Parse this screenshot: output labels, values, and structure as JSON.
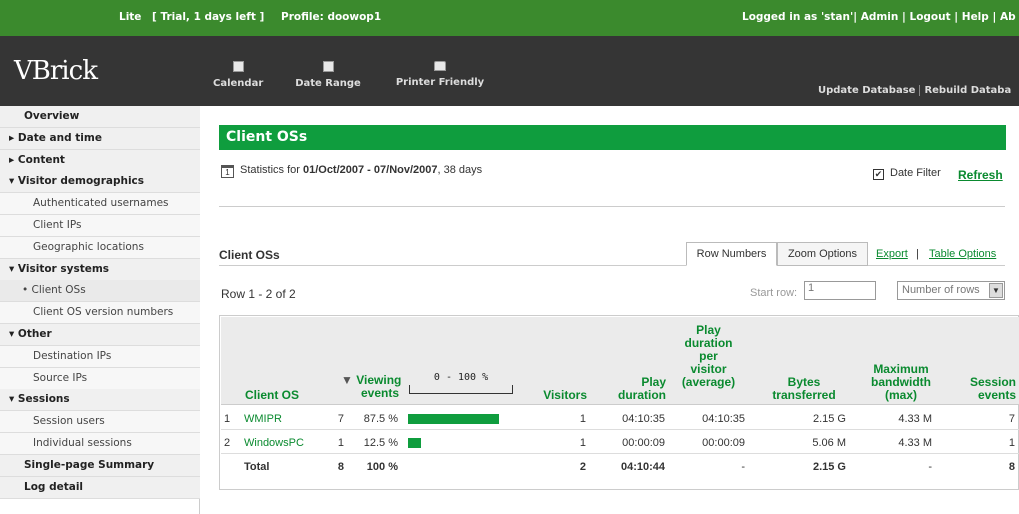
{
  "topbar": {
    "edition": "Lite",
    "trial": "[ Trial, 1 days left ]",
    "profile": "Profile: doowop1",
    "right": "Logged in as 'stan'| Admin | Logout | Help | Ab"
  },
  "header": {
    "logo": "VBrick",
    "tools": [
      {
        "label": "Calendar",
        "icon": "calendar-icon"
      },
      {
        "label": "Date Range",
        "icon": "date-range-icon"
      },
      {
        "label": "Printer Friendly",
        "icon": "printer-icon"
      }
    ],
    "update_db": "Update Database",
    "rebuild_db": "Rebuild Databa"
  },
  "sidebar": {
    "items": [
      {
        "label": "Overview",
        "kind": "top"
      },
      {
        "label": "▸ Date and time",
        "kind": "grp"
      },
      {
        "label": "▸ Content",
        "kind": "grp"
      },
      {
        "label": "▾ Visitor demographics",
        "kind": "grp"
      },
      {
        "label": "Authenticated usernames",
        "kind": "sub"
      },
      {
        "label": "Client IPs",
        "kind": "sub"
      },
      {
        "label": "Geographic locations",
        "kind": "sub"
      },
      {
        "label": "▾ Visitor systems",
        "kind": "grp"
      },
      {
        "label": "• Client OSs",
        "kind": "sub sel"
      },
      {
        "label": "Client OS version numbers",
        "kind": "sub"
      },
      {
        "label": "▾ Other",
        "kind": "grp"
      },
      {
        "label": "Destination IPs",
        "kind": "sub"
      },
      {
        "label": "Source IPs",
        "kind": "sub"
      },
      {
        "label": "▾ Sessions",
        "kind": "grp"
      },
      {
        "label": "Session users",
        "kind": "sub"
      },
      {
        "label": "Individual sessions",
        "kind": "sub"
      },
      {
        "label": "Single-page Summary",
        "kind": "top"
      },
      {
        "label": "Log detail",
        "kind": "top"
      }
    ]
  },
  "main": {
    "title": "Client OSs",
    "stats_prefix": "Statistics for",
    "stats_range": "01/Oct/2007 - 07/Nov/2007",
    "stats_suffix": ", 38 days",
    "date_filter_label": "Date Filter",
    "date_filter_checked": true,
    "refresh": "Refresh",
    "subtitle": "Client OSs",
    "tabs": {
      "row_numbers": "Row Numbers",
      "zoom_options": "Zoom Options"
    },
    "export": "Export",
    "link_sep": "|",
    "table_options": "Table Options",
    "row_count": "Row 1 - 2 of 2",
    "start_row_label": "Start row:",
    "start_row_value": "1",
    "num_rows_placeholder": "Number of rows"
  },
  "table": {
    "headers": {
      "client_os": "Client OS",
      "viewing_events": "Viewing\nevents",
      "sort_arrow": "▼",
      "scale": "0 - 100 %",
      "visitors": "Visitors",
      "play_duration": "Play\nduration",
      "play_per_visitor": "Play\nduration\nper\nvisitor\n(average)",
      "bytes": "Bytes\ntransferred",
      "max_bw": "Maximum\nbandwidth\n(max)",
      "session_events": "Session\nevents"
    },
    "rows": [
      {
        "num": "1",
        "os": "WMIPR",
        "events": "7",
        "pct": "87.5 %",
        "fraction": 0.875,
        "visitors": "1",
        "play": "04:10:35",
        "per_visitor": "04:10:35",
        "bytes": "2.15 G",
        "max_bw": "4.33 M",
        "sessions": "7"
      },
      {
        "num": "2",
        "os": "WindowsPC",
        "events": "1",
        "pct": "12.5 %",
        "fraction": 0.125,
        "visitors": "1",
        "play": "00:00:09",
        "per_visitor": "00:00:09",
        "bytes": "5.06 M",
        "max_bw": "4.33 M",
        "sessions": "1"
      }
    ],
    "total": {
      "label": "Total",
      "events": "8",
      "pct": "100 %",
      "visitors": "2",
      "play": "04:10:44",
      "per_visitor": "-",
      "bytes": "2.15 G",
      "max_bw": "-",
      "sessions": "8"
    }
  },
  "colors": {
    "accent": "#0f9d3e",
    "topbar": "#3b8a2d",
    "header": "#353535"
  }
}
